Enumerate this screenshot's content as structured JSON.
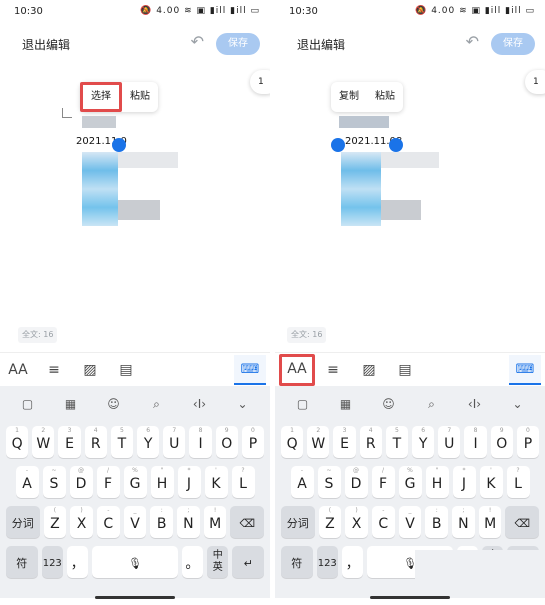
{
  "status": {
    "time": "10:30",
    "icons": "🔕 4.00 ≋ ▣ ▮ill ▮ill ▭"
  },
  "left": {
    "appbar": {
      "back_label": "退出编辑",
      "save_label": "保存"
    },
    "popup": {
      "select": "选择",
      "paste": "粘贴"
    },
    "selected_text": "2021.11.0",
    "page_number": "1",
    "wordcount": "全文: 16"
  },
  "right": {
    "appbar": {
      "back_label": "退出编辑",
      "save_label": "保存"
    },
    "popup": {
      "copy": "复制",
      "paste": "粘贴"
    },
    "selected_text": "2021.11.08",
    "page_number": "1",
    "wordcount": "全文: 16"
  },
  "toolbar": {
    "aa": "AA",
    "align": "≡",
    "image": "▨",
    "clipboard": "▤",
    "keyboard": "⌨"
  },
  "keyboard_top": [
    "▢",
    "▦",
    "☺",
    "⌕",
    "‹I›",
    "⌄"
  ],
  "keys": {
    "row1": [
      {
        "k": "Q",
        "s": "1"
      },
      {
        "k": "W",
        "s": "2"
      },
      {
        "k": "E",
        "s": "3"
      },
      {
        "k": "R",
        "s": "4"
      },
      {
        "k": "T",
        "s": "5"
      },
      {
        "k": "Y",
        "s": "6"
      },
      {
        "k": "U",
        "s": "7"
      },
      {
        "k": "I",
        "s": "8"
      },
      {
        "k": "O",
        "s": "9"
      },
      {
        "k": "P",
        "s": "0"
      }
    ],
    "row2": [
      {
        "k": "A",
        "s": "-"
      },
      {
        "k": "S",
        "s": "~"
      },
      {
        "k": "D",
        "s": "@"
      },
      {
        "k": "F",
        "s": "/"
      },
      {
        "k": "G",
        "s": "%"
      },
      {
        "k": "H",
        "s": "\""
      },
      {
        "k": "J",
        "s": "*"
      },
      {
        "k": "K",
        "s": "'"
      },
      {
        "k": "L",
        "s": "?"
      }
    ],
    "row3": [
      {
        "k": "Z",
        "s": "("
      },
      {
        "k": "X",
        "s": ")"
      },
      {
        "k": "C",
        "s": "-"
      },
      {
        "k": "V",
        "s": "_"
      },
      {
        "k": "B",
        "s": ":"
      },
      {
        "k": "N",
        "s": ";"
      },
      {
        "k": "M",
        "s": "!"
      }
    ],
    "fen_ci": "分词",
    "backspace": "⌫",
    "fu": "符",
    "num": "123",
    "comma": "，",
    "mic": "🎙",
    "period": "。",
    "zh": "中",
    "ying": "英",
    "enter": "↵"
  },
  "colors": {
    "accent": "#1a73e8",
    "highlight": "#e14b4b",
    "save_bg": "#a9c9f1"
  }
}
